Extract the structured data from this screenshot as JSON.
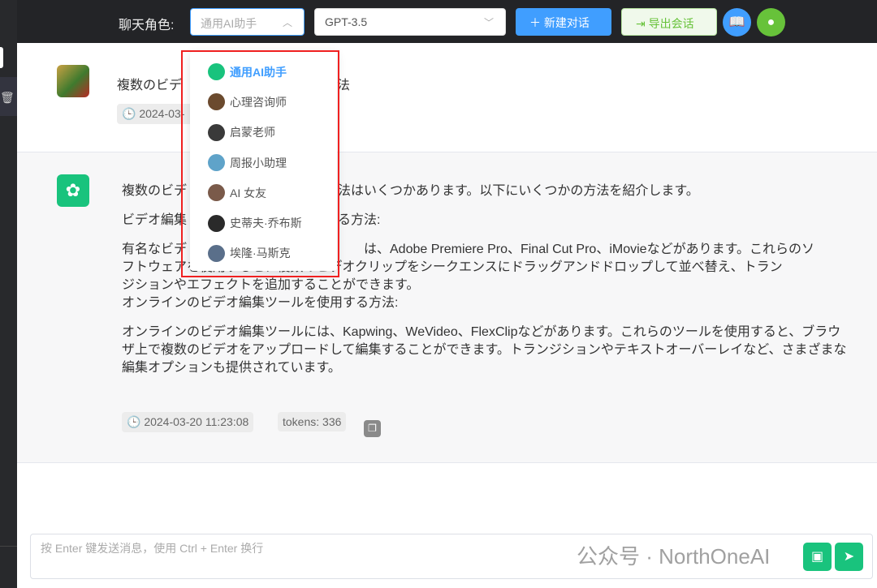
{
  "header": {
    "role_label": "聊天角色:",
    "role_value": "通用AI助手",
    "model_value": "GPT-3.5",
    "new_chat": "＋ 新建对话",
    "export": "导出会话"
  },
  "roles": [
    {
      "name": "通用AI助手",
      "color": "#19c37d"
    },
    {
      "name": "心理咨询师",
      "color": "#6b4a2e"
    },
    {
      "name": "启蒙老师",
      "color": "#3a3a3a"
    },
    {
      "name": "周报小助理",
      "color": "#5fa3c9"
    },
    {
      "name": "AI 女友",
      "color": "#7a5a4a"
    },
    {
      "name": "史蒂夫·乔布斯",
      "color": "#2a2a2a"
    },
    {
      "name": "埃隆·马斯克",
      "color": "#5a6f8a"
    }
  ],
  "user_msg": {
    "left": "複数のビデ",
    "right": "法",
    "time": "2024-03-"
  },
  "reply": {
    "l1a": "複数のビデ",
    "l1b": "法はいくつかあります。以下にいくつかの方法を紹介します。",
    "l2a": "ビデオ編集",
    "l2b": "る方法:",
    "l3a": "有名なビデ",
    "l3b": "は、Adobe Premiere Pro、Final Cut Pro、iMovieなどがあります。これらのソ",
    "l3c": "フトウェアを使用すると、複数のビデオクリップをシークエンスにドラッグアンドドロップして並べ替え、トラン",
    "l3d": "ジションやエフェクトを追加することができます。",
    "l3e": "オンラインのビデオ編集ツールを使用する方法:",
    "p4": "オンラインのビデオ編集ツールには、Kapwing、WeVideo、FlexClipなどがあります。これらのツールを使用すると、ブラウザ上で複数のビデオをアップロードして編集することができます。トランジションやテキストオーバーレイなど、さまざまな編集オプションも提供されています。",
    "time": "2024-03-20 11:23:08",
    "tokens": "tokens: 336"
  },
  "input": {
    "placeholder": "按 Enter 键发送消息，使用 Ctrl + Enter 换行"
  },
  "watermark": "公众号 · NorthOneAI"
}
